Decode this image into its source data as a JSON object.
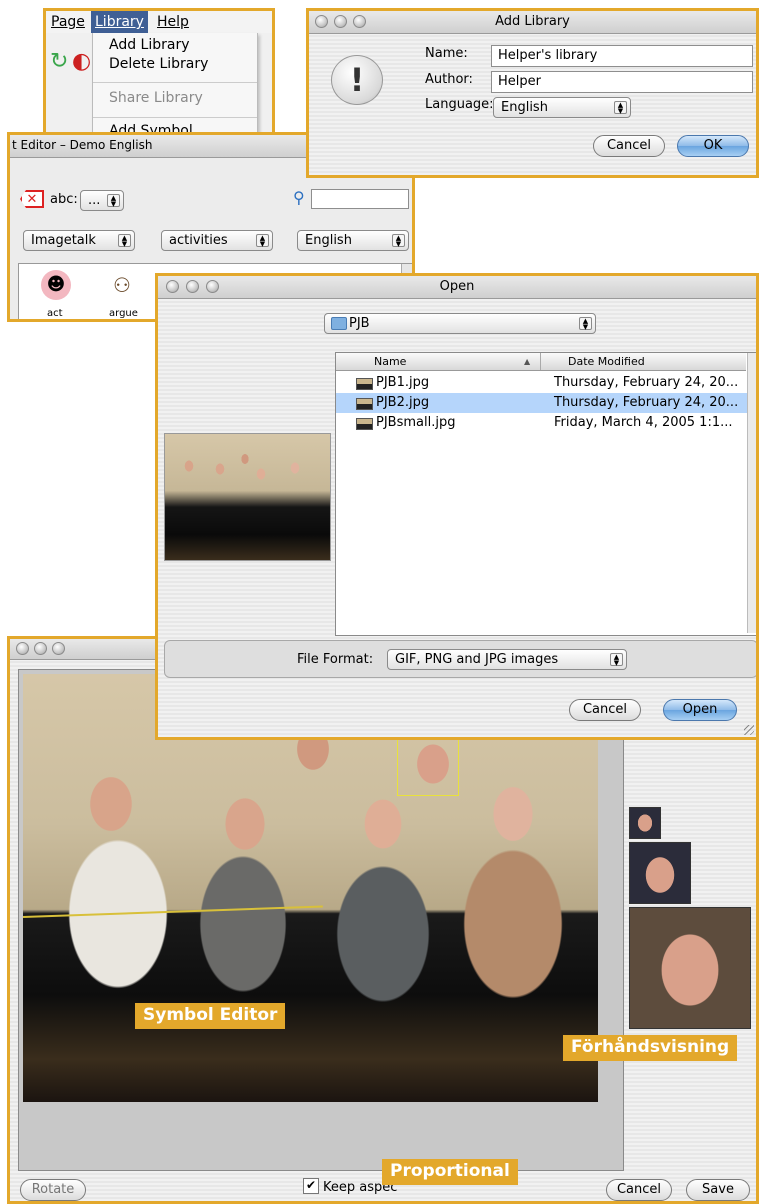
{
  "menu": {
    "items": [
      "Page",
      "Library",
      "Help"
    ],
    "dropdown": [
      "Add Library",
      "Delete Library",
      "Share Library",
      "Add Symbol"
    ]
  },
  "add_library": {
    "title": "Add Library",
    "name_label": "Name:",
    "name_value": "Helper's library",
    "author_label": "Author:",
    "author_value": "Helper",
    "language_label": "Language:",
    "language_value": "English",
    "cancel": "Cancel",
    "ok": "OK"
  },
  "editor": {
    "title": "t Editor – Demo English",
    "abc": "abc:",
    "abc_value": "...",
    "library_value": "Imagetalk",
    "category_value": "activities",
    "language_value": "English",
    "symbols": [
      "act",
      "argue"
    ]
  },
  "open_dialog": {
    "title": "Open",
    "folder": "PJB",
    "col_name": "Name",
    "col_date": "Date Modified",
    "files": [
      {
        "name": "PJB1.jpg",
        "date": "Thursday, February 24, 20..."
      },
      {
        "name": "PJB2.jpg",
        "date": "Thursday, February 24, 20..."
      },
      {
        "name": "PJBsmall.jpg",
        "date": "Friday, March 4, 2005 1:1..."
      }
    ],
    "format_label": "File Format:",
    "format_value": "GIF, PNG and JPG images",
    "cancel": "Cancel",
    "open": "Open"
  },
  "symbol_editor": {
    "rotate": "Rotate",
    "keep_aspect": "Keep aspec",
    "cancel": "Cancel",
    "save": "Save"
  },
  "callouts": {
    "symbol_editor": "Symbol Editor",
    "preview": "Förhåndsvisning",
    "proportional": "Proportional"
  },
  "colors": {
    "accent": "#e3a82b",
    "selection": "#b5d5fb"
  }
}
